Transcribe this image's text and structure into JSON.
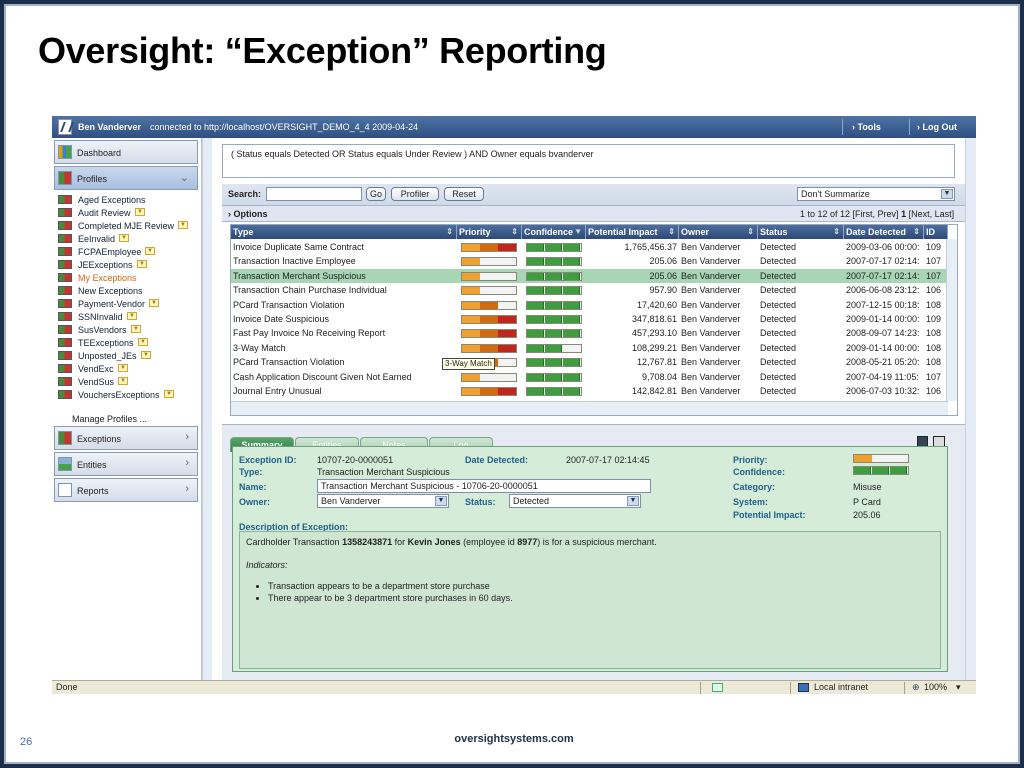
{
  "slide": {
    "title": "Oversight: “Exception” Reporting",
    "number": "26",
    "footer": "oversightsystems.com"
  },
  "topbar": {
    "user": "Ben Vanderver",
    "connection": "connected to http://localhost/OVERSIGHT_DEMO_4_4  2009-04-24",
    "tools": "› Tools",
    "logout": "› Log Out"
  },
  "sidebar": {
    "dashboard": "Dashboard",
    "profiles": "Profiles",
    "items": [
      {
        "label": "Aged Exceptions",
        "dd": false
      },
      {
        "label": "Audit Review",
        "dd": true
      },
      {
        "label": "Completed MJE Review",
        "dd": true
      },
      {
        "label": "EeInvalid",
        "dd": true
      },
      {
        "label": "FCPAEmployee",
        "dd": true
      },
      {
        "label": "JEExceptions",
        "dd": true
      },
      {
        "label": "My Exceptions",
        "dd": false,
        "active": true
      },
      {
        "label": "New Exceptions",
        "dd": false
      },
      {
        "label": "Payment-Vendor",
        "dd": true
      },
      {
        "label": "SSNInvalid",
        "dd": true
      },
      {
        "label": "SusVendors",
        "dd": true
      },
      {
        "label": "TEExceptions",
        "dd": true
      },
      {
        "label": "Unposted_JEs",
        "dd": true
      },
      {
        "label": "VendExc",
        "dd": true
      },
      {
        "label": "VendSus",
        "dd": true
      },
      {
        "label": "VouchersExceptions",
        "dd": true
      }
    ],
    "manage": "Manage Profiles ...",
    "exceptions": "Exceptions",
    "entities": "Entities",
    "reports": "Reports"
  },
  "filter": "( Status equals Detected OR Status equals Under Review ) AND Owner equals bvanderver",
  "search": {
    "label": "Search:",
    "value": "",
    "go": "Go",
    "profiler": "Profiler",
    "reset": "Reset",
    "summarize": "Don't Summarize",
    "options": "› Options",
    "paging_prefix": "1 to 12 of 12 [First, Prev]",
    "paging_current": "1",
    "paging_suffix": "[Next, Last]"
  },
  "grid": {
    "columns": [
      "Type",
      "Priority",
      "Confidence",
      "Potential Impact",
      "Owner",
      "Status",
      "Date Detected",
      "ID"
    ],
    "rows": [
      {
        "type": "Invoice Duplicate Same Contract",
        "priority": 3,
        "confidence": 3,
        "impact": "1,765,456.37",
        "owner": "Ben Vanderver",
        "status": "Detected",
        "date": "2009-03-06 00:00:",
        "id": "109"
      },
      {
        "type": "Transaction Inactive Employee",
        "priority": 1,
        "confidence": 3,
        "impact": "205.06",
        "owner": "Ben Vanderver",
        "status": "Detected",
        "date": "2007-07-17 02:14:",
        "id": "107"
      },
      {
        "type": "Transaction Merchant Suspicious",
        "priority": 1,
        "confidence": 3,
        "impact": "205.06",
        "owner": "Ben Vanderver",
        "status": "Detected",
        "date": "2007-07-17 02:14:",
        "id": "107",
        "selected": true
      },
      {
        "type": "Transaction Chain Purchase Individual",
        "priority": 1,
        "confidence": 3,
        "impact": "957.90",
        "owner": "Ben Vanderver",
        "status": "Detected",
        "date": "2006-06-08 23:12:",
        "id": "106"
      },
      {
        "type": "PCard Transaction Violation",
        "priority": 2,
        "confidence": 3,
        "impact": "17,420.60",
        "owner": "Ben Vanderver",
        "status": "Detected",
        "date": "2007-12-15 00:18:",
        "id": "108"
      },
      {
        "type": "Invoice Date Suspicious",
        "priority": 3,
        "confidence": 3,
        "impact": "347,818.61",
        "owner": "Ben Vanderver",
        "status": "Detected",
        "date": "2009-01-14 00:00:",
        "id": "109"
      },
      {
        "type": "Fast Pay Invoice No Receiving Report",
        "priority": 3,
        "confidence": 3,
        "impact": "457,293.10",
        "owner": "Ben Vanderver",
        "status": "Detected",
        "date": "2008-09-07 14:23:",
        "id": "108"
      },
      {
        "type": "3-Way Match",
        "priority": 3,
        "confidence": 2,
        "impact": "108,299.21",
        "owner": "Ben Vanderver",
        "status": "Detected",
        "date": "2009-01-14 00:00:",
        "id": "108"
      },
      {
        "type": "PCard Transaction Violation",
        "priority": 2,
        "confidence": 3,
        "impact": "12,767.81",
        "owner": "Ben Vanderver",
        "status": "Detected",
        "date": "2008-05-21 05:20:",
        "id": "108"
      },
      {
        "type": "Cash Application Discount Given Not Earned",
        "priority": 1,
        "confidence": 3,
        "impact": "9,708.04",
        "owner": "Ben Vanderver",
        "status": "Detected",
        "date": "2007-04-19 11:05:",
        "id": "107"
      },
      {
        "type": "Journal Entry Unusual",
        "priority": 3,
        "confidence": 3,
        "impact": "142,842.81",
        "owner": "Ben Vanderver",
        "status": "Detected",
        "date": "2006-07-03 10:32:",
        "id": "106"
      }
    ],
    "tooltip": "3-Way Match"
  },
  "tabs": [
    "Summary",
    "Entities",
    "Notes",
    "Log"
  ],
  "detail": {
    "exception_id_label": "Exception ID:",
    "exception_id": "10707-20-0000051",
    "date_label": "Date Detected:",
    "date": "2007-07-17 02:14:45",
    "type_label": "Type:",
    "type": "Transaction Merchant Suspicious",
    "name_label": "Name:",
    "name": "Transaction Merchant Suspicious - 10706-20-0000051",
    "owner_label": "Owner:",
    "owner": "Ben Vanderver",
    "status_label": "Status:",
    "status": "Detected",
    "priority_label": "Priority:",
    "confidence_label": "Confidence:",
    "category_label": "Category:",
    "category": "Misuse",
    "system_label": "System:",
    "system": "P Card",
    "impact_label": "Potential Impact:",
    "impact": "205.06",
    "desc_label": "Description of Exception:",
    "desc_pre": "Cardholder Transaction ",
    "desc_card": "1358243871",
    "desc_mid": " for ",
    "desc_person": "Kevin Jones",
    "desc_emp": " (employee id ",
    "desc_empid": "8977",
    "desc_post": ") is for a suspicious merchant.",
    "indicators": "Indicators:",
    "bullets": [
      "Transaction appears to be a department store purchase",
      "There appear to be 3 department store purchases in 60 days."
    ],
    "priority_level": 1,
    "confidence_level": 3
  },
  "statusbar": {
    "left": "Done",
    "zone": "Local intranet",
    "zoom": "100%"
  },
  "colors": {
    "orange": "#f0a030",
    "darkorange": "#d26a10",
    "red": "#c0261c",
    "green": "#3e9d3e",
    "header": "#2d4a78"
  }
}
